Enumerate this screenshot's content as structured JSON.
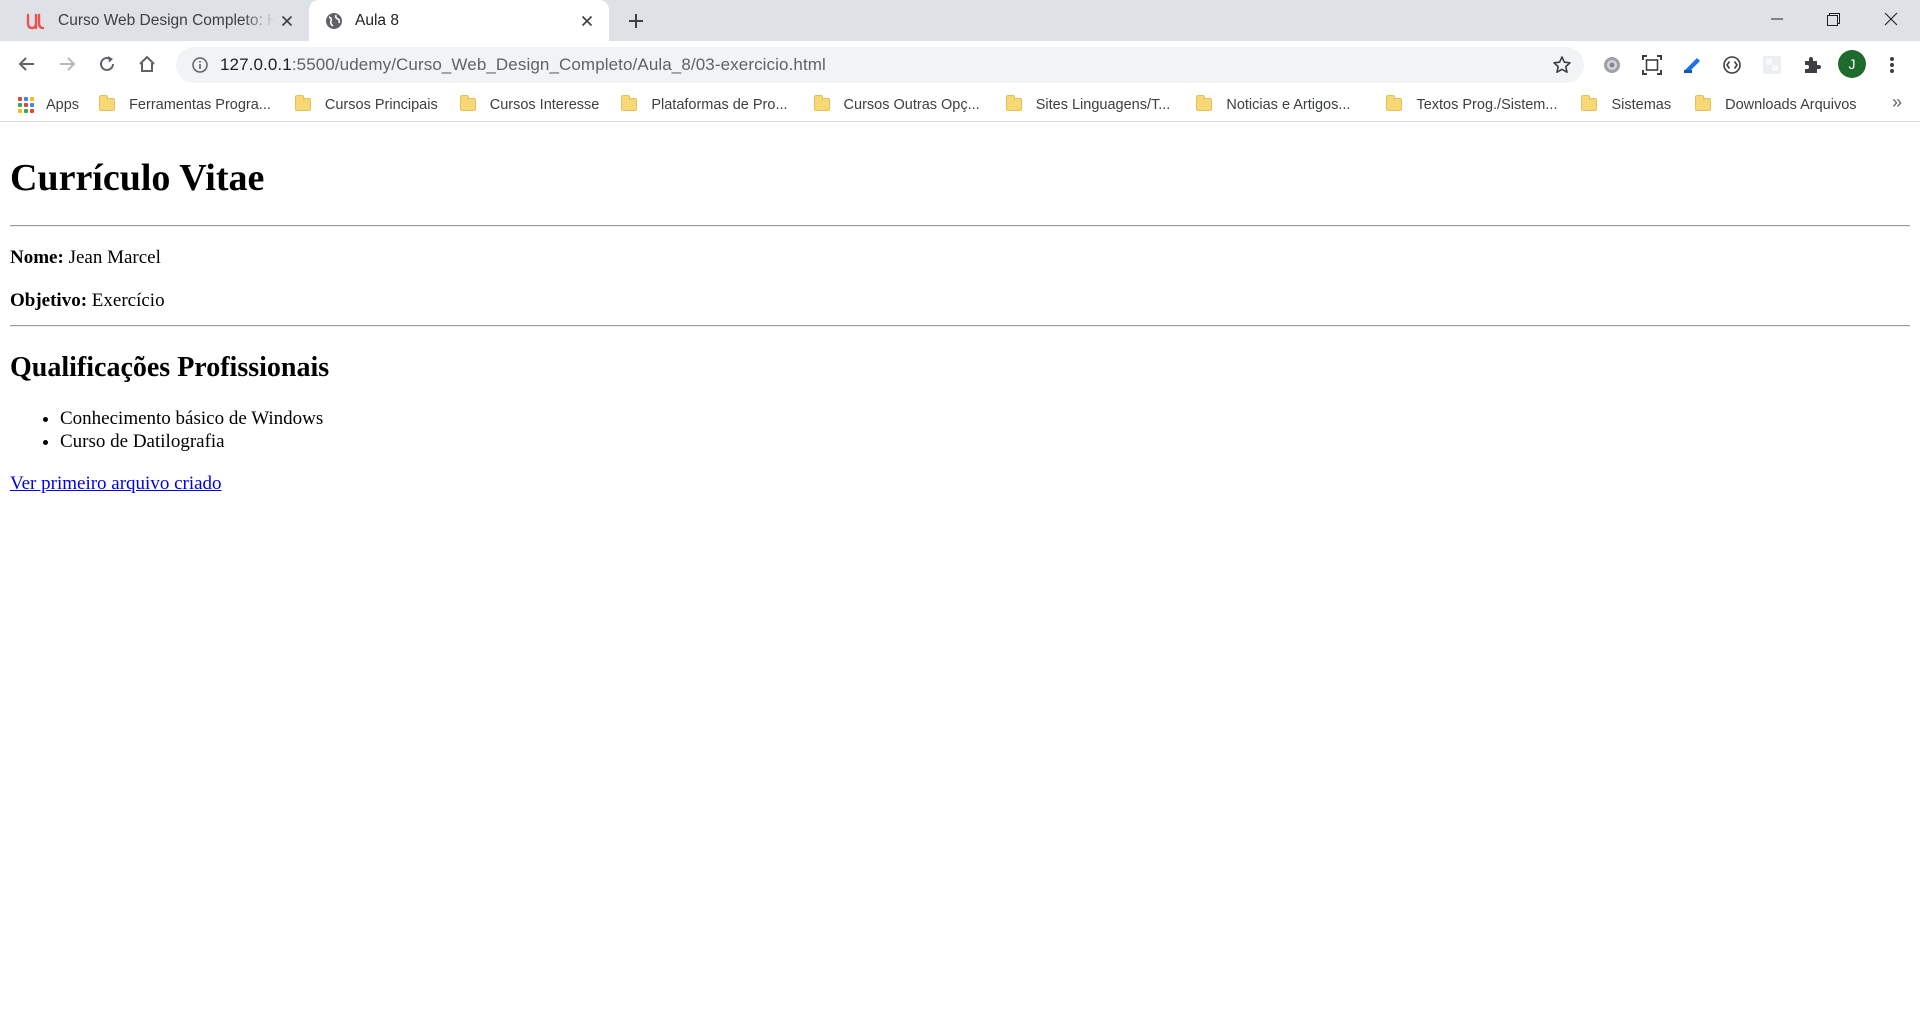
{
  "browser": {
    "tabs": [
      {
        "title": "Curso Web Design Completo: HTML5, CSS3, JavaScript e jQuery | Udemy",
        "active": false,
        "icon": "udemy-icon"
      },
      {
        "title": "Aula 8",
        "active": true,
        "icon": "globe-icon"
      }
    ],
    "address": {
      "host": "127.0.0.1",
      "path": ":5500/udemy/Curso_Web_Design_Completo/Aula_8/03-exercicio.html"
    },
    "profile_initial": "J",
    "bookmarks": [
      {
        "label": "Apps",
        "type": "apps"
      },
      {
        "label": "Ferramentas Progra...",
        "type": "folder"
      },
      {
        "label": "Cursos Principais",
        "type": "folder"
      },
      {
        "label": "Cursos Interesse",
        "type": "folder"
      },
      {
        "label": "Plataformas de Pro...",
        "type": "folder"
      },
      {
        "label": "Cursos Outras Opç...",
        "type": "folder"
      },
      {
        "label": "Sites Linguagens/T...",
        "type": "folder"
      },
      {
        "label": "Noticias e Artigos...",
        "type": "folder"
      },
      {
        "label": "Textos Prog./Sistem...",
        "type": "folder"
      },
      {
        "label": "Sistemas",
        "type": "folder"
      },
      {
        "label": "Downloads Arquivos",
        "type": "folder"
      }
    ],
    "bookmarks_overflow": "»"
  },
  "page": {
    "title": "Currículo Vitae",
    "nome_label": "Nome:",
    "nome_value": " Jean Marcel",
    "objetivo_label": "Objetivo:",
    "objetivo_value": " Exercício",
    "section_title": "Qualificações Profissionais",
    "qualifications": [
      "Conhecimento básico de Windows",
      "Curso de Datilografia"
    ],
    "link_text": "Ver primeiro arquivo criado"
  },
  "colors": {
    "tabstrip": "#dee1e6",
    "omnibox": "#f1f3f4",
    "link": "#0000ee",
    "udemy": "#ec5252",
    "avatar": "#1e6b2d"
  }
}
